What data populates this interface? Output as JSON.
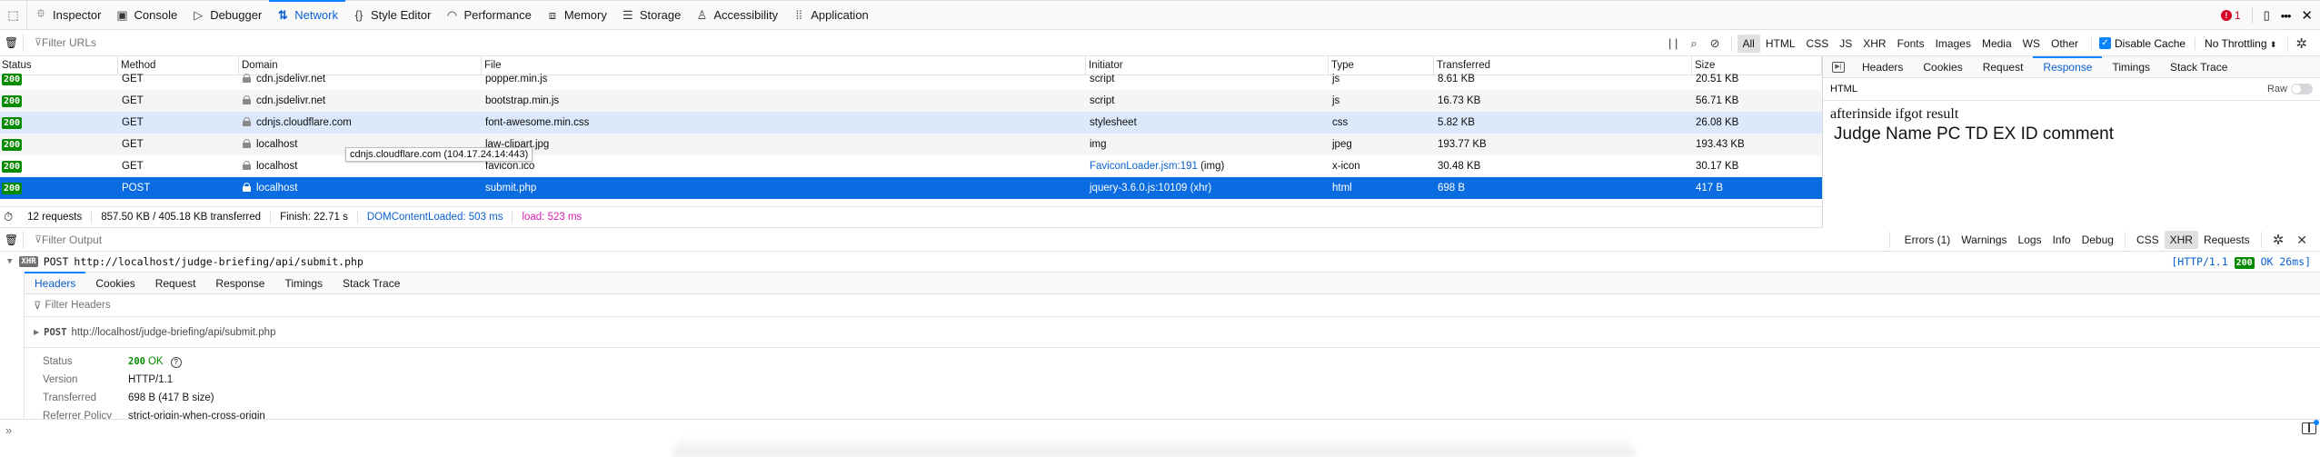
{
  "toolbar": {
    "tools": [
      {
        "icon": "inspector-icon",
        "glyph": "⯐",
        "label": "Inspector"
      },
      {
        "icon": "console-icon",
        "glyph": "▣",
        "label": "Console"
      },
      {
        "icon": "debugger-icon",
        "glyph": "▷",
        "label": "Debugger"
      },
      {
        "icon": "network-icon",
        "glyph": "⇅",
        "label": "Network",
        "active": true
      },
      {
        "icon": "style-editor-icon",
        "glyph": "{}",
        "label": "Style Editor"
      },
      {
        "icon": "performance-icon",
        "glyph": "◠",
        "label": "Performance"
      },
      {
        "icon": "memory-icon",
        "glyph": "⧈",
        "label": "Memory"
      },
      {
        "icon": "storage-icon",
        "glyph": "☰",
        "label": "Storage"
      },
      {
        "icon": "accessibility-icon",
        "glyph": "♙",
        "label": "Accessibility"
      },
      {
        "icon": "application-icon",
        "glyph": "⁞⁞",
        "label": "Application"
      }
    ],
    "error_count": "1"
  },
  "network_filter": {
    "placeholder": "Filter URLs",
    "type_filters": [
      "All",
      "HTML",
      "CSS",
      "JS",
      "XHR",
      "Fonts",
      "Images",
      "Media",
      "WS",
      "Other"
    ],
    "active_type": "All",
    "disable_cache_label": "Disable Cache",
    "disable_cache_checked": true,
    "throttling": "No Throttling"
  },
  "table": {
    "columns": [
      "Status",
      "Method",
      "Domain",
      "File",
      "Initiator",
      "Type",
      "Transferred",
      "Size"
    ],
    "rows": [
      {
        "status": "200",
        "method": "GET",
        "domain": "cdn.jsdelivr.net",
        "file": "popper.min.js",
        "initiator": "script",
        "initiator_extra": "",
        "type": "js",
        "transferred": "8.61 KB",
        "size": "20.51 KB"
      },
      {
        "status": "200",
        "method": "GET",
        "domain": "cdn.jsdelivr.net",
        "file": "bootstrap.min.js",
        "initiator": "script",
        "initiator_extra": "",
        "type": "js",
        "transferred": "16.73 KB",
        "size": "56.71 KB"
      },
      {
        "status": "200",
        "method": "GET",
        "domain": "cdnjs.cloudflare.com",
        "file": "font-awesome.min.css",
        "initiator": "stylesheet",
        "initiator_extra": "",
        "type": "css",
        "transferred": "5.82 KB",
        "size": "26.08 KB"
      },
      {
        "status": "200",
        "method": "GET",
        "domain": "localhost",
        "file": "law-clipart.jpg",
        "initiator": "img",
        "initiator_extra": "",
        "type": "jpeg",
        "transferred": "193.77 KB",
        "size": "193.43 KB"
      },
      {
        "status": "200",
        "method": "GET",
        "domain": "localhost",
        "file": "favicon.ico",
        "initiator": "FaviconLoader.jsm:191",
        "initiator_extra": " (img)",
        "type": "x-icon",
        "transferred": "30.48 KB",
        "size": "30.17 KB"
      },
      {
        "status": "200",
        "method": "POST",
        "domain": "localhost",
        "file": "submit.php",
        "initiator": "jquery-3.6.0.js:10109 (xhr)",
        "initiator_extra": "",
        "type": "html",
        "transferred": "698 B",
        "size": "417 B"
      }
    ],
    "tooltip": "cdnjs.cloudflare.com (104.17.24.14:443)"
  },
  "summary": {
    "requests": "12 requests",
    "transferred": "857.50 KB / 405.18 KB transferred",
    "finish": "Finish: 22.71 s",
    "dom_content_loaded": "DOMContentLoaded: 503 ms",
    "load": "load: 523 ms"
  },
  "detail_panel": {
    "tabs": [
      "Headers",
      "Cookies",
      "Request",
      "Response",
      "Timings",
      "Stack Trace"
    ],
    "active_tab": "Response",
    "format_label": "HTML",
    "raw_label": "Raw",
    "raw_enabled": false,
    "response_line1": "afterinside ifgot result",
    "response_line2": "Judge Name PC TD EX ID comment"
  },
  "console": {
    "filter_placeholder": "Filter Output",
    "level_filters": [
      "Errors (1)",
      "Warnings",
      "Logs",
      "Info",
      "Debug"
    ],
    "type_filters": [
      "CSS",
      "XHR",
      "Requests"
    ],
    "active_type_filter": "XHR",
    "message": {
      "tag": "XHR",
      "method": "POST",
      "url": "http://localhost/judge-briefing/api/submit.php",
      "protocol": "[HTTP/1.1",
      "status_code": "200",
      "status_text": "OK 26ms]"
    },
    "detail": {
      "tabs": [
        "Headers",
        "Cookies",
        "Request",
        "Response",
        "Timings",
        "Stack Trace"
      ],
      "active_tab": "Headers",
      "filter_placeholder": "Filter Headers",
      "request_method": "POST",
      "request_url": "http://localhost/judge-briefing/api/submit.php",
      "headers": [
        {
          "key": "Status",
          "value_code": "200",
          "value_text": "OK"
        },
        {
          "key": "Version",
          "value": "HTTP/1.1"
        },
        {
          "key": "Transferred",
          "value": "698 B (417 B size)"
        },
        {
          "key": "Referrer Policy",
          "value": "strict-origin-when-cross-origin"
        }
      ]
    },
    "prompt_symbol": "»"
  }
}
